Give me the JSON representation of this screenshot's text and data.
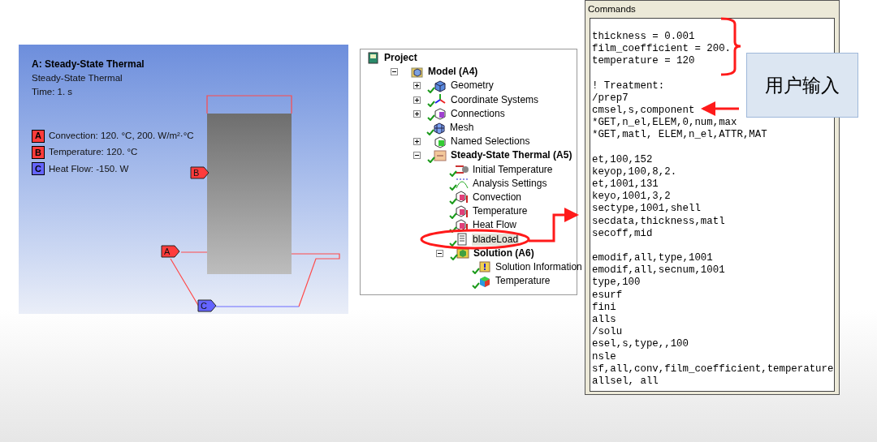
{
  "viewport": {
    "title": "A: Steady-State Thermal",
    "subtitle": "Steady-State Thermal",
    "time": "Time: 1. s",
    "legend": [
      {
        "letter": "A",
        "label": "Convection: 120. °C, 200. W/m²·°C",
        "color": "#ff3b3b"
      },
      {
        "letter": "B",
        "label": "Temperature: 120. °C",
        "color": "#ff3b3b"
      },
      {
        "letter": "C",
        "label": "Heat Flow: -150. W",
        "color": "#6464ff"
      }
    ],
    "markers": [
      {
        "letter": "B",
        "color": "#ff3b3b"
      },
      {
        "letter": "A",
        "color": "#ff3b3b"
      },
      {
        "letter": "C",
        "color": "#6464ff"
      }
    ]
  },
  "tree": {
    "items": [
      {
        "label": "Project",
        "kind": "project",
        "checked": false,
        "selected": false,
        "bold": true,
        "children": [
          {
            "label": "Model (A4)",
            "kind": "model",
            "expanded": true,
            "checked": false,
            "selected": false,
            "bold": true,
            "children": [
              {
                "label": "Geometry",
                "kind": "geometry",
                "expanded": false,
                "checked": true,
                "selected": false,
                "bold": false
              },
              {
                "label": "Coordinate Systems",
                "kind": "coords",
                "expanded": false,
                "checked": true,
                "selected": false,
                "bold": false
              },
              {
                "label": "Connections",
                "kind": "connections",
                "expanded": false,
                "checked": true,
                "selected": false,
                "bold": false
              },
              {
                "label": "Mesh",
                "kind": "mesh",
                "checked": true,
                "selected": false,
                "bold": false
              },
              {
                "label": "Named Selections",
                "kind": "named",
                "expanded": false,
                "checked": false,
                "selected": false,
                "bold": false
              },
              {
                "label": "Steady-State Thermal (A5)",
                "kind": "analysis",
                "expanded": true,
                "checked": true,
                "selected": false,
                "bold": true,
                "children": [
                  {
                    "label": "Initial Temperature",
                    "kind": "init",
                    "checked": true,
                    "selected": false,
                    "bold": false
                  },
                  {
                    "label": "Analysis Settings",
                    "kind": "settings",
                    "checked": true,
                    "selected": false,
                    "bold": false
                  },
                  {
                    "label": "Convection",
                    "kind": "load",
                    "checked": true,
                    "selected": false,
                    "bold": false
                  },
                  {
                    "label": "Temperature",
                    "kind": "load",
                    "checked": true,
                    "selected": false,
                    "bold": false
                  },
                  {
                    "label": "Heat Flow",
                    "kind": "load",
                    "checked": true,
                    "selected": false,
                    "bold": false
                  },
                  {
                    "label": "bladeLoad",
                    "kind": "commands",
                    "checked": true,
                    "selected": true,
                    "bold": false
                  },
                  {
                    "label": "Solution (A6)",
                    "kind": "solution",
                    "expanded": true,
                    "checked": true,
                    "selected": false,
                    "bold": true,
                    "children": [
                      {
                        "label": "Solution Information",
                        "kind": "info",
                        "checked": true,
                        "selected": false,
                        "bold": false
                      },
                      {
                        "label": "Temperature",
                        "kind": "result",
                        "checked": true,
                        "selected": false,
                        "bold": false
                      }
                    ]
                  }
                ]
              }
            ]
          }
        ]
      }
    ]
  },
  "commands": {
    "title": "Commands",
    "blocks": [
      [
        "thickness = 0.001",
        "film_coefficient = 200.",
        "temperature = 120"
      ],
      [
        "! Treatment:",
        "/prep7",
        "cmsel,s,component",
        "*GET,n_el,ELEM,0,num,max",
        "*GET,matl, ELEM,n_el,ATTR,MAT"
      ],
      [
        "et,100,152",
        "keyop,100,8,2.",
        "et,1001,131",
        "keyo,1001,3,2",
        "sectype,1001,shell",
        "secdata,thickness,matl",
        "secoff,mid"
      ],
      [
        "emodif,all,type,1001",
        "emodif,all,secnum,1001",
        "type,100",
        "esurf",
        "fini",
        "alls",
        "/solu",
        "esel,s,type,,100",
        "nsle",
        "sf,all,conv,film_coefficient,temperature",
        "allsel, all"
      ]
    ]
  },
  "callout": {
    "text": "用户输入"
  }
}
